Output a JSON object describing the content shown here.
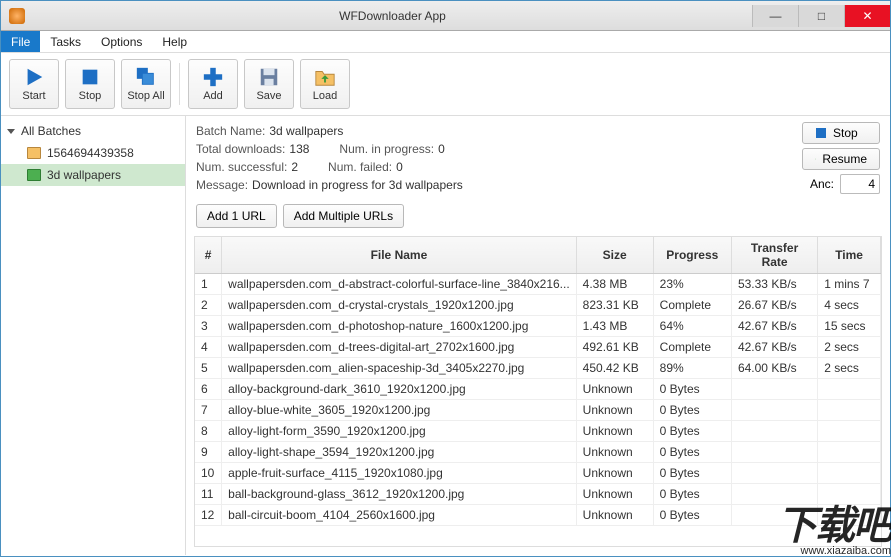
{
  "window": {
    "title": "WFDownloader App"
  },
  "menu": {
    "file": "File",
    "tasks": "Tasks",
    "options": "Options",
    "help": "Help"
  },
  "toolbar": {
    "start": "Start",
    "stop": "Stop",
    "stopall": "Stop All",
    "add": "Add",
    "save": "Save",
    "load": "Load"
  },
  "sidebar": {
    "root": "All Batches",
    "items": [
      {
        "label": "1564694439358"
      },
      {
        "label": "3d wallpapers"
      }
    ]
  },
  "info": {
    "batch_name_lbl": "Batch Name:",
    "batch_name": "3d wallpapers",
    "total_lbl": "Total downloads:",
    "total": "138",
    "inprog_lbl": "Num. in progress:",
    "inprog": "0",
    "success_lbl": "Num. successful:",
    "success": "2",
    "failed_lbl": "Num. failed:",
    "failed": "0",
    "message_lbl": "Message:",
    "message": "Download in progress for 3d wallpapers"
  },
  "sidebuttons": {
    "stop": "Stop",
    "resume": "Resume",
    "anc_lbl": "Anc:",
    "anc_val": "4"
  },
  "urlbuttons": {
    "add1": "Add 1 URL",
    "addmulti": "Add Multiple URLs"
  },
  "table": {
    "headers": {
      "num": "#",
      "name": "File Name",
      "size": "Size",
      "progress": "Progress",
      "rate": "Transfer Rate",
      "time": "Time"
    },
    "rows": [
      {
        "n": "1",
        "name": "wallpapersden.com_d-abstract-colorful-surface-line_3840x216...",
        "size": "4.38 MB",
        "prog": "23%",
        "rate": "53.33 KB/s",
        "time": "1 mins 7"
      },
      {
        "n": "2",
        "name": "wallpapersden.com_d-crystal-crystals_1920x1200.jpg",
        "size": "823.31 KB",
        "prog": "Complete",
        "rate": "26.67 KB/s",
        "time": "4 secs"
      },
      {
        "n": "3",
        "name": "wallpapersden.com_d-photoshop-nature_1600x1200.jpg",
        "size": "1.43 MB",
        "prog": "64%",
        "rate": "42.67 KB/s",
        "time": "15 secs"
      },
      {
        "n": "4",
        "name": "wallpapersden.com_d-trees-digital-art_2702x1600.jpg",
        "size": "492.61 KB",
        "prog": "Complete",
        "rate": "42.67 KB/s",
        "time": "2 secs"
      },
      {
        "n": "5",
        "name": "wallpapersden.com_alien-spaceship-3d_3405x2270.jpg",
        "size": "450.42 KB",
        "prog": "89%",
        "rate": "64.00 KB/s",
        "time": "2 secs"
      },
      {
        "n": "6",
        "name": "alloy-background-dark_3610_1920x1200.jpg",
        "size": "Unknown",
        "prog": "0 Bytes",
        "rate": "",
        "time": ""
      },
      {
        "n": "7",
        "name": "alloy-blue-white_3605_1920x1200.jpg",
        "size": "Unknown",
        "prog": "0 Bytes",
        "rate": "",
        "time": ""
      },
      {
        "n": "8",
        "name": "alloy-light-form_3590_1920x1200.jpg",
        "size": "Unknown",
        "prog": "0 Bytes",
        "rate": "",
        "time": ""
      },
      {
        "n": "9",
        "name": "alloy-light-shape_3594_1920x1200.jpg",
        "size": "Unknown",
        "prog": "0 Bytes",
        "rate": "",
        "time": ""
      },
      {
        "n": "10",
        "name": "apple-fruit-surface_4115_1920x1080.jpg",
        "size": "Unknown",
        "prog": "0 Bytes",
        "rate": "",
        "time": ""
      },
      {
        "n": "11",
        "name": "ball-background-glass_3612_1920x1200.jpg",
        "size": "Unknown",
        "prog": "0 Bytes",
        "rate": "",
        "time": ""
      },
      {
        "n": "12",
        "name": "ball-circuit-boom_4104_2560x1600.jpg",
        "size": "Unknown",
        "prog": "0 Bytes",
        "rate": "",
        "time": ""
      }
    ]
  },
  "watermark": {
    "main": "下载吧",
    "sub": "www.xiazaiba.com"
  }
}
